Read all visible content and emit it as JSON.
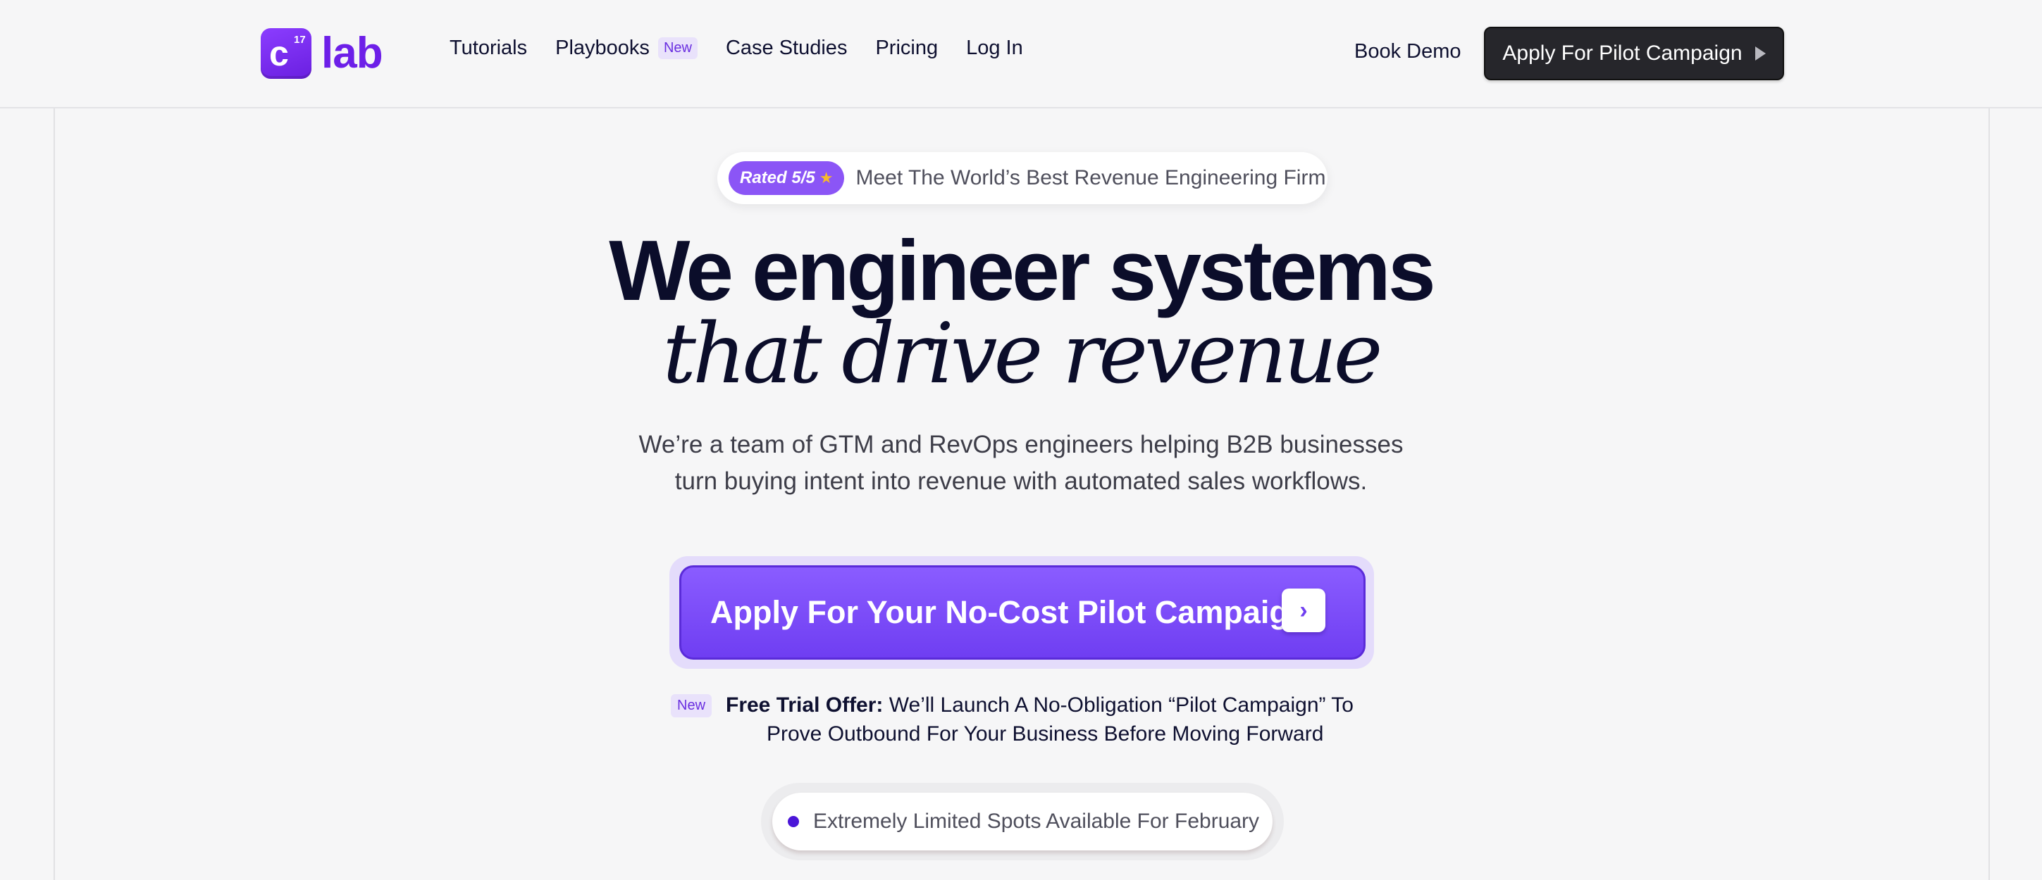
{
  "logo": {
    "mark_letter": "c",
    "mark_superscript": "17",
    "word": "lab"
  },
  "nav": {
    "items": [
      {
        "label": "Tutorials"
      },
      {
        "label": "Playbooks",
        "badge": "New"
      },
      {
        "label": "Case Studies"
      },
      {
        "label": "Pricing"
      },
      {
        "label": "Log In"
      }
    ],
    "book_demo": "Book Demo",
    "cta": "Apply For Pilot Campaign"
  },
  "hero": {
    "rating_badge": "Rated 5/5",
    "rating_star": "★",
    "rating_text": "Meet The World’s Best Revenue Engineering Firm",
    "headline_line1": "We engineer systems",
    "headline_line2": "that drive revenue",
    "sub_line1": "We’re a team of GTM and RevOps engineers helping B2B businesses",
    "sub_line2": "turn buying intent into revenue with automated sales workflows.",
    "cta_label": "Apply For Your No-Cost Pilot Campaign",
    "cta_arrow": "›",
    "trial_badge": "New",
    "trial_label": "Free Trial Offer:",
    "trial_text_line1": " We’ll Launch A No-Obligation “Pilot Campaign” To",
    "trial_text_line2": "Prove Outbound For Your Business Before Moving Forward",
    "spots_text": "Extremely Limited Spots Available For February"
  },
  "colors": {
    "brand_purple": "#6d1fe8",
    "cta_purple": "#7b4bf7",
    "dark_button": "#26262b",
    "headline": "#0b0d2a",
    "star": "#f7b928"
  }
}
